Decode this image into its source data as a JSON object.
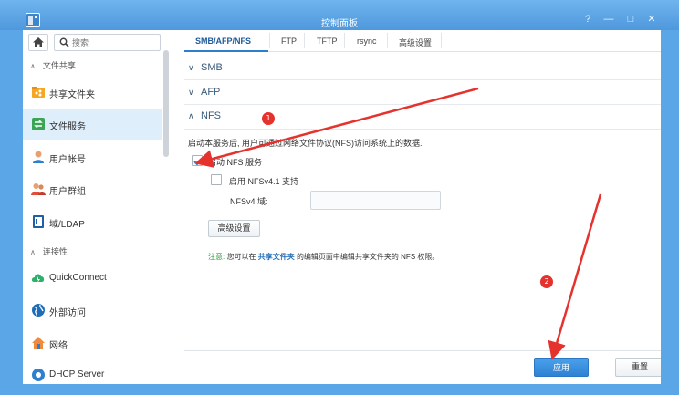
{
  "window": {
    "title": "控制面板"
  },
  "titlebar": {
    "buttons": [
      {
        "name": "help-icon",
        "glyph": "?"
      },
      {
        "name": "minimize-icon",
        "glyph": "—"
      },
      {
        "name": "maximize-icon",
        "glyph": "□"
      },
      {
        "name": "close-icon",
        "glyph": "✕"
      }
    ]
  },
  "sidebar": {
    "search_placeholder": "搜索",
    "sections": [
      {
        "label": "文件共享",
        "chevron": "∧"
      },
      {
        "label": "连接性",
        "chevron": "∧"
      }
    ],
    "items": [
      {
        "label": "共享文件夹",
        "icon": "shared-folder-icon",
        "active": false
      },
      {
        "label": "文件服务",
        "icon": "file-services-icon",
        "active": true
      },
      {
        "label": "用户帐号",
        "icon": "user-icon",
        "active": false
      },
      {
        "label": "用户群组",
        "icon": "group-icon",
        "active": false
      },
      {
        "label": "域/LDAP",
        "icon": "domain-ldap-icon",
        "active": false
      },
      {
        "label": "QuickConnect",
        "icon": "quickconnect-icon",
        "active": false
      },
      {
        "label": "外部访问",
        "icon": "external-access-icon",
        "active": false
      },
      {
        "label": "网络",
        "icon": "network-icon",
        "active": false
      },
      {
        "label": "DHCP Server",
        "icon": "dhcp-server-icon",
        "active": false
      }
    ]
  },
  "tabs": [
    {
      "label": "SMB/AFP/NFS",
      "active": true
    },
    {
      "label": "FTP",
      "active": false
    },
    {
      "label": "TFTP",
      "active": false
    },
    {
      "label": "rsync",
      "active": false
    },
    {
      "label": "高级设置",
      "active": false
    }
  ],
  "protocols": [
    {
      "label": "SMB",
      "caret": "∨"
    },
    {
      "label": "AFP",
      "caret": "∨"
    },
    {
      "label": "NFS",
      "caret": "∧"
    }
  ],
  "nfs": {
    "description": "启动本服务后, 用户可通过网络文件协议(NFS)访问系统上的数据.",
    "enable_label": "启动 NFS 服务",
    "enable_checked": true,
    "nfsv41_label": "启用 NFSv4.1 支持",
    "nfsv41_checked": false,
    "nfsv4_domain_label": "NFSv4 域:",
    "nfsv4_domain_value": "",
    "advanced_button": "高级设置",
    "note_label": "注意:",
    "note_text_1": "您可以在",
    "note_link": "共享文件夹",
    "note_text_2": "的编辑页面中编辑共享文件夹的 NFS 权限。"
  },
  "footer": {
    "apply": "应用",
    "reset": "重置"
  },
  "annotations": [
    {
      "label": "1",
      "color": "#e5322d"
    },
    {
      "label": "2",
      "color": "#e5322d"
    }
  ],
  "colors": {
    "accent": "#2f82d3",
    "titlebar": "#5aa6e6",
    "annotation": "#e5322d",
    "active_row": "#dfeefb"
  }
}
